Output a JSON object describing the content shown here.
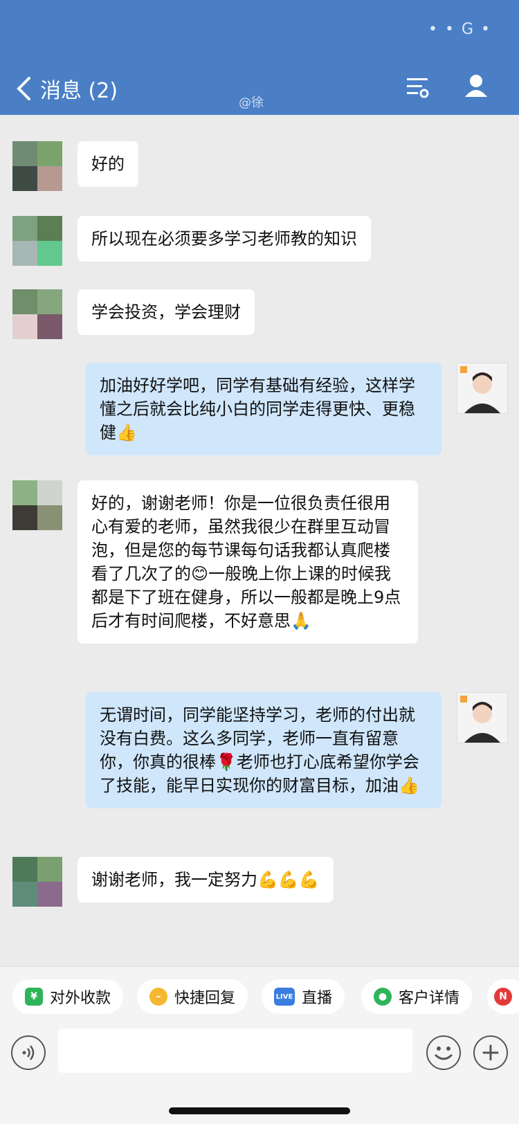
{
  "header": {
    "title": "消息 (2)",
    "watermark": "@徐",
    "bg_color": "#4a7fc6"
  },
  "messages": [
    {
      "side": "left",
      "text": "好的"
    },
    {
      "side": "left",
      "text": "所以现在必须要多学习老师教的知识"
    },
    {
      "side": "left",
      "text": "学会投资，学会理财"
    },
    {
      "side": "right",
      "text": "加油好好学吧，同学有基础有经验，这样学懂之后就会比纯小白的同学走得更快、更稳健👍"
    },
    {
      "side": "left",
      "text": "好的，谢谢老师！你是一位很负责任很用心有爱的老师，虽然我很少在群里互动冒泡，但是您的每节课每句话我都认真爬楼看了几次了的😊一般晚上你上课的时候我都是下了班在健身，所以一般都是晚上9点后才有时间爬楼，不好意思🙏"
    },
    {
      "side": "right",
      "text": "无谓时间，同学能坚持学习，老师的付出就没有白费。这么多同学，老师一直有留意你，你真的很棒🌹老师也打心底希望你学会了技能，能早日实现你的财富目标，加油👍"
    },
    {
      "side": "left",
      "text": "谢谢老师，我一定努力💪💪💪"
    }
  ],
  "quick_actions": [
    {
      "label": "对外收款",
      "icon": "yuan-shield-icon",
      "color": "#2fb45a"
    },
    {
      "label": "快捷回复",
      "icon": "reply-bubble-icon",
      "color": "#f5b82e"
    },
    {
      "label": "直播",
      "icon": "live-icon",
      "color": "#3a7de0"
    },
    {
      "label": "客户详情",
      "icon": "customer-icon",
      "color": "#2fb45a"
    }
  ]
}
